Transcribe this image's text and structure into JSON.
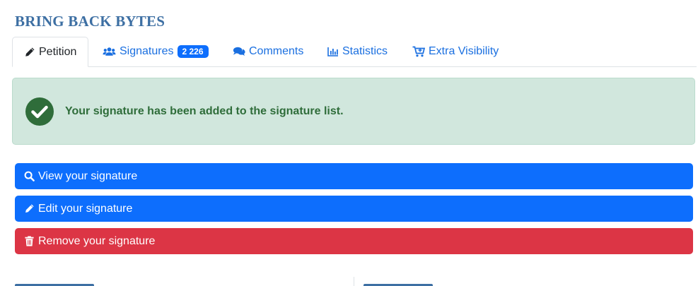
{
  "page": {
    "title": "BRING BACK BYTES"
  },
  "tabs": [
    {
      "label": "Petition",
      "icon": "pencil-icon",
      "active": true
    },
    {
      "label": "Signatures",
      "icon": "users-icon",
      "badge": "2 226",
      "active": false
    },
    {
      "label": "Comments",
      "icon": "comments-icon",
      "active": false
    },
    {
      "label": "Statistics",
      "icon": "bar-chart-icon",
      "active": false
    },
    {
      "label": "Extra Visibility",
      "icon": "cart-plus-icon",
      "active": false
    }
  ],
  "alert": {
    "icon": "check-circle-icon",
    "message": "Your signature has been added to the signature list.",
    "color": "#2f6d3a"
  },
  "actions": [
    {
      "label": "View your signature",
      "icon": "search-icon",
      "color": "#0d6efd"
    },
    {
      "label": "Edit your signature",
      "icon": "pencil-icon",
      "color": "#0d6efd"
    },
    {
      "label": "Remove your signature",
      "icon": "trash-icon",
      "color": "#dc3545"
    }
  ]
}
